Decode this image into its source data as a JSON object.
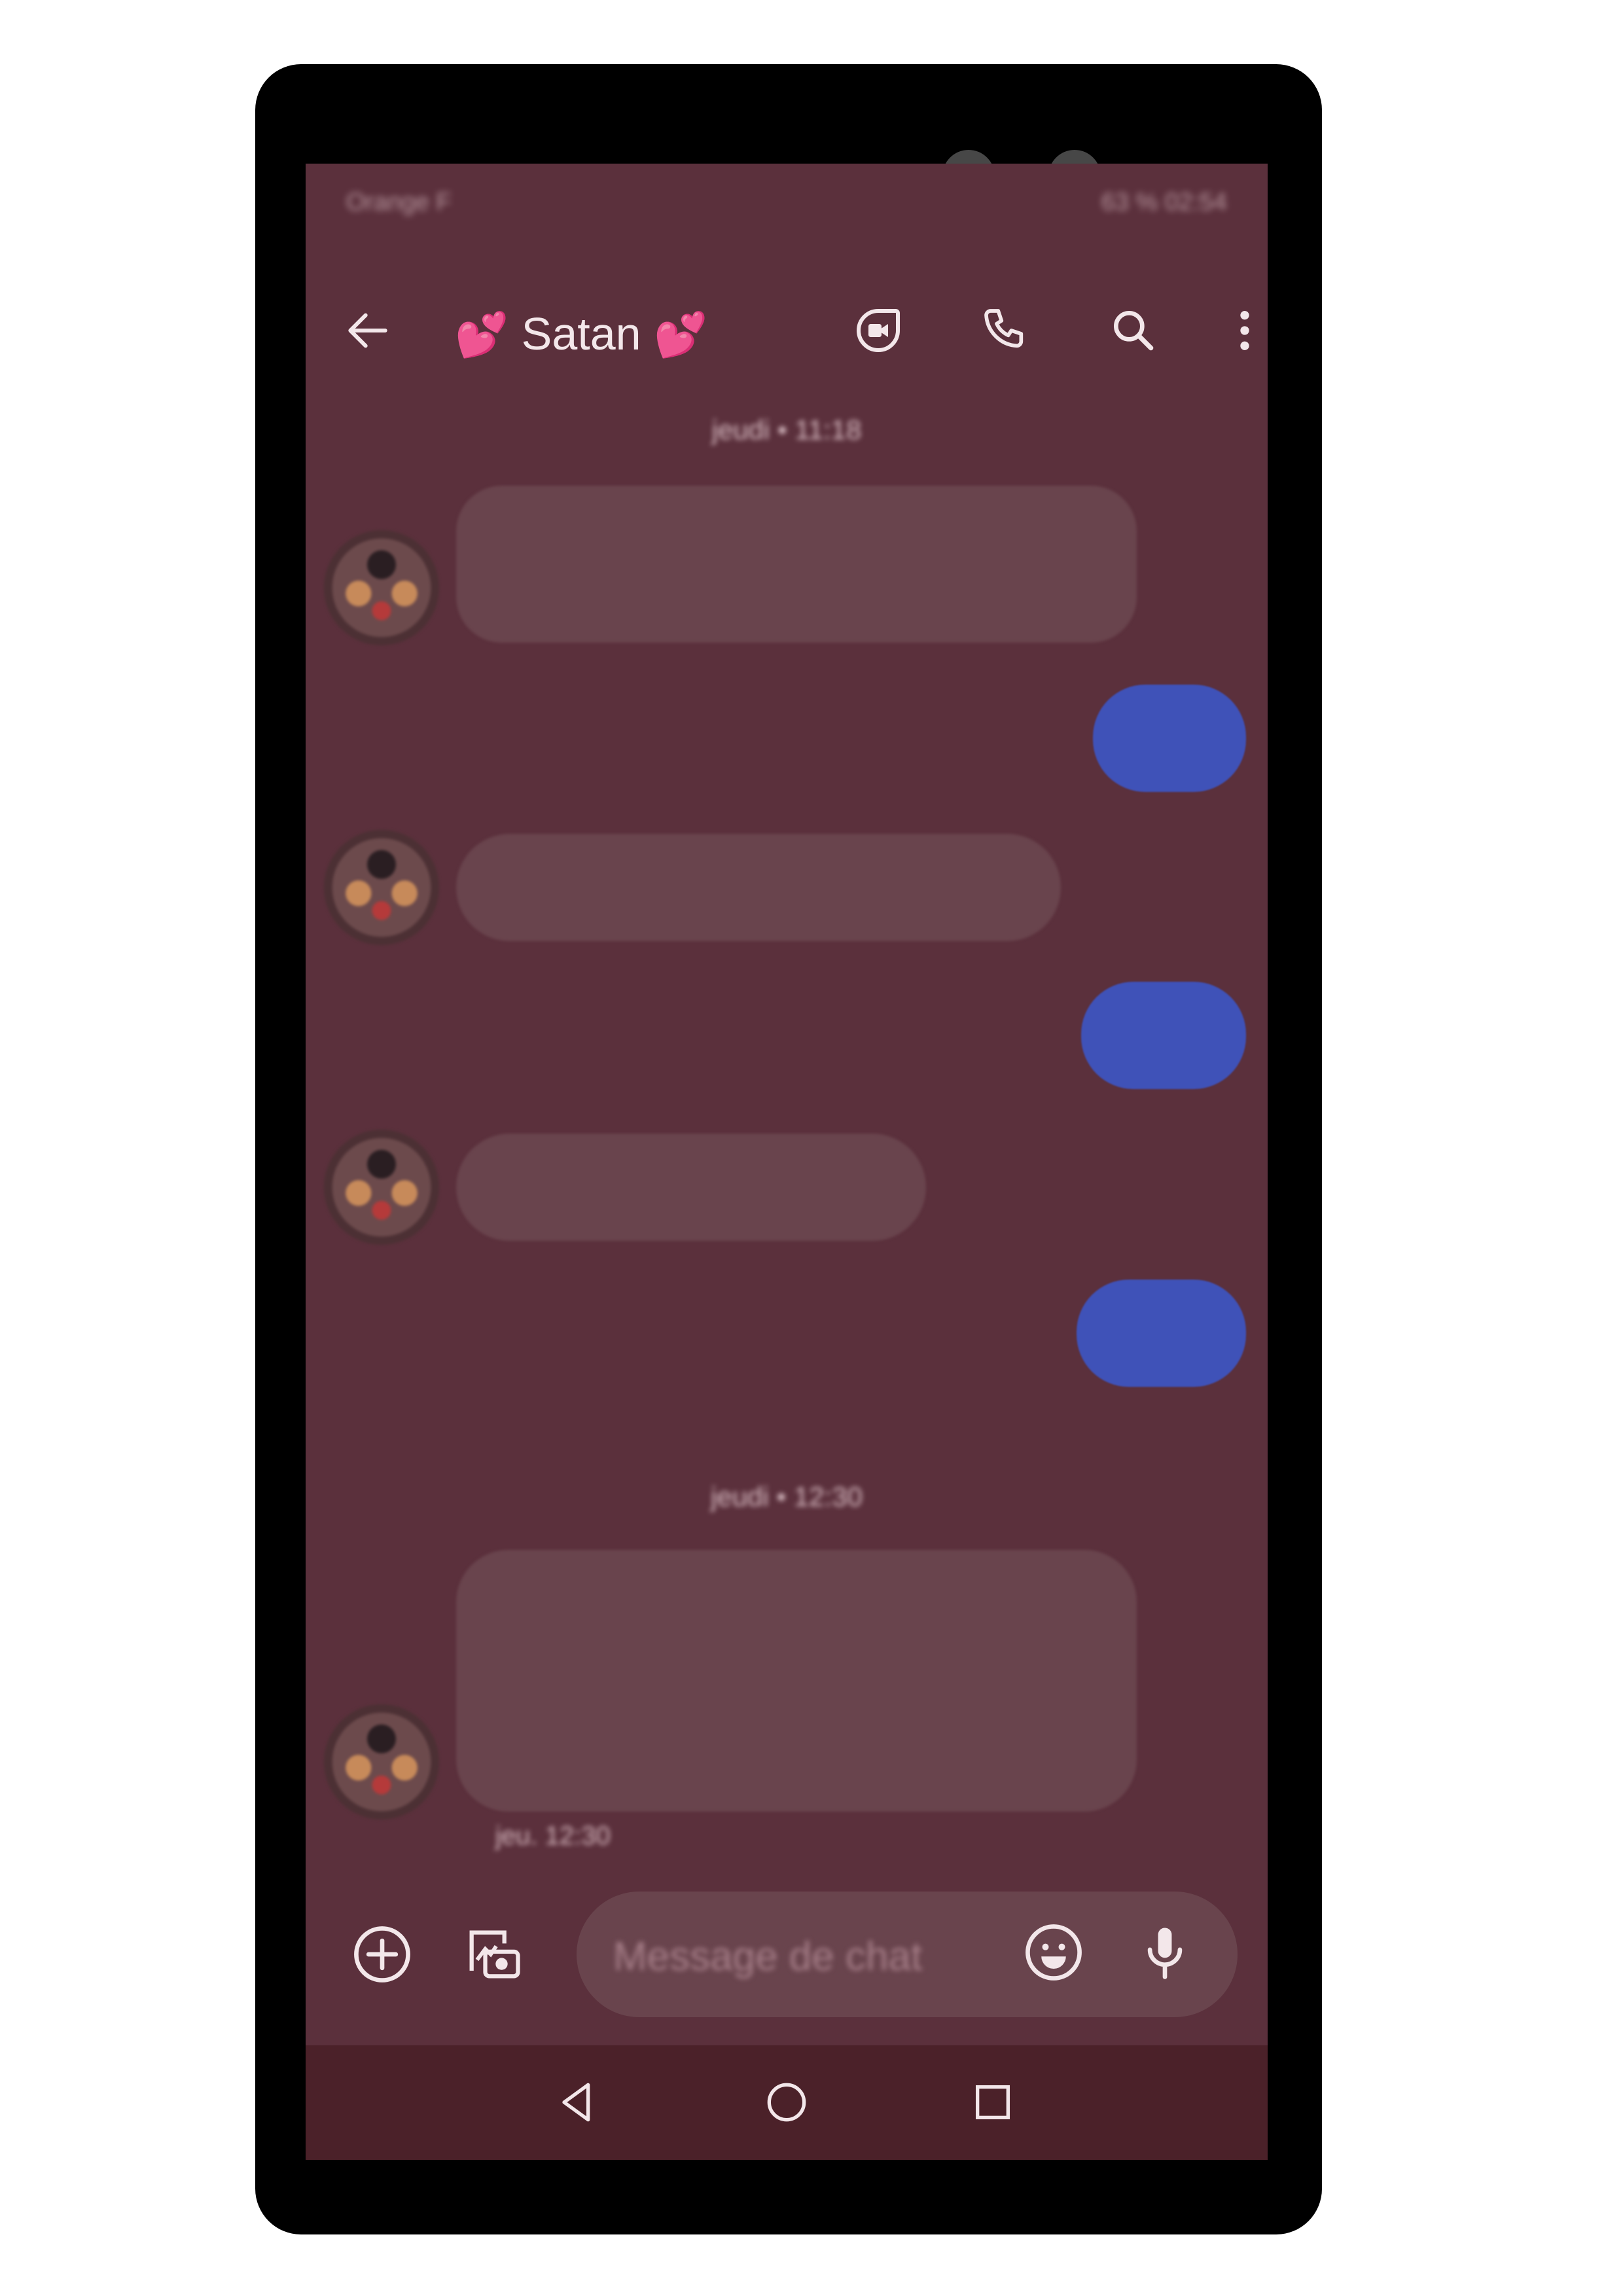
{
  "status_bar": {
    "carrier": "Orange F",
    "right": "63 % 02:54"
  },
  "header": {
    "title": "Satan",
    "title_emoji_left": "💕",
    "title_emoji_right": "💕"
  },
  "conversation": {
    "date_separators": [
      "jeudi • 11:18",
      "jeudi • 12:30"
    ],
    "last_message_meta": "jeu. 12:30"
  },
  "composer": {
    "placeholder": "Message de chat"
  },
  "colors": {
    "screen_bg": "#5b303c",
    "incoming_bubble": "#69444d",
    "outgoing_bubble": "#3f52b8",
    "nav_bar": "#4b2129",
    "phone_frame": "#000000"
  },
  "icons": [
    "back-arrow-icon",
    "video-call-icon",
    "phone-icon",
    "search-icon",
    "more-vert-icon",
    "add-icon",
    "gallery-camera-icon",
    "emoji-icon",
    "mic-icon",
    "nav-back-icon",
    "nav-home-icon",
    "nav-recents-icon"
  ]
}
